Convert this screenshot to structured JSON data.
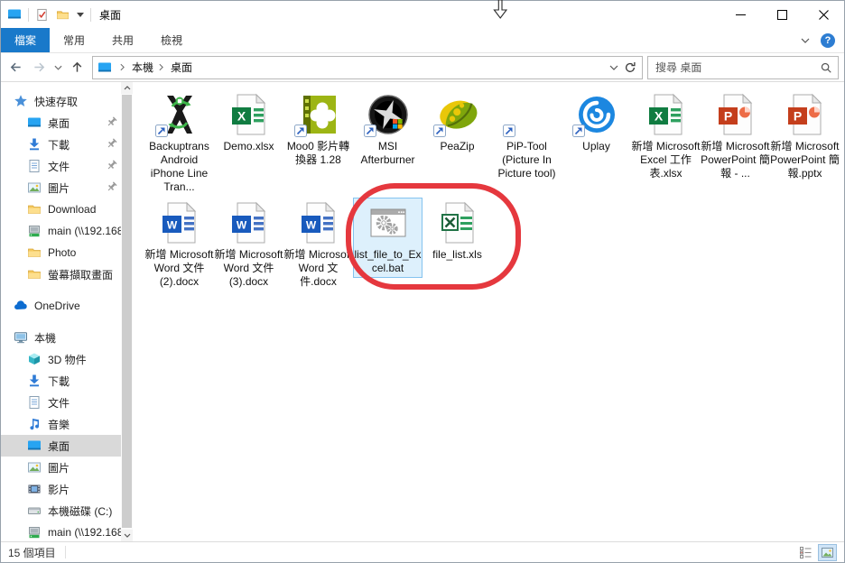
{
  "window": {
    "title": "桌面"
  },
  "ribbon": {
    "file_tab": "檔案",
    "tabs": [
      {
        "label": "常用"
      },
      {
        "label": "共用"
      },
      {
        "label": "檢視"
      }
    ]
  },
  "navigation": {
    "path_segments": [
      {
        "label": "本機"
      },
      {
        "label": "桌面"
      }
    ],
    "search_placeholder": "搜尋 桌面"
  },
  "sidebar": {
    "items": [
      {
        "label": "快速存取",
        "icon": "quickaccess",
        "level": 0
      },
      {
        "label": "桌面",
        "icon": "desktop",
        "level": 1,
        "pinned": true
      },
      {
        "label": "下載",
        "icon": "download",
        "level": 1,
        "pinned": true
      },
      {
        "label": "文件",
        "icon": "document",
        "level": 1,
        "pinned": true
      },
      {
        "label": "圖片",
        "icon": "pictures",
        "level": 1,
        "pinned": true
      },
      {
        "label": "Download",
        "icon": "folder",
        "level": 1
      },
      {
        "label": "main (\\\\192.168",
        "icon": "network",
        "level": 1
      },
      {
        "label": "Photo",
        "icon": "folder",
        "level": 1
      },
      {
        "label": "螢幕擷取畫面",
        "icon": "folder",
        "level": 1
      },
      {
        "label": "OneDrive",
        "icon": "onedrive",
        "level": 0,
        "gap": true
      },
      {
        "label": "本機",
        "icon": "thispc",
        "level": 0,
        "gap": true
      },
      {
        "label": "3D 物件",
        "icon": "objects3d",
        "level": 1
      },
      {
        "label": "下載",
        "icon": "download",
        "level": 1
      },
      {
        "label": "文件",
        "icon": "document",
        "level": 1
      },
      {
        "label": "音樂",
        "icon": "music",
        "level": 1
      },
      {
        "label": "桌面",
        "icon": "desktop",
        "level": 1,
        "selected": true
      },
      {
        "label": "圖片",
        "icon": "pictures",
        "level": 1
      },
      {
        "label": "影片",
        "icon": "videos",
        "level": 1
      },
      {
        "label": "本機磁碟 (C:)",
        "icon": "disk",
        "level": 1
      },
      {
        "label": "main (\\\\192.168",
        "icon": "network",
        "level": 1
      }
    ]
  },
  "files": [
    {
      "label": "Backuptrans Android iPhone Line Tran...",
      "icon": "backuptrans",
      "shortcut": true
    },
    {
      "label": "Demo.xlsx",
      "icon": "excel"
    },
    {
      "label": "Moo0 影片轉換器 1.28",
      "icon": "moo0",
      "shortcut": true
    },
    {
      "label": "MSI Afterburner",
      "icon": "msi",
      "shortcut": true
    },
    {
      "label": "PeaZip",
      "icon": "peazip",
      "shortcut": true
    },
    {
      "label": "PiP-Tool (Picture In Picture tool)",
      "icon": "blank",
      "shortcut": true
    },
    {
      "label": "Uplay",
      "icon": "uplay",
      "shortcut": true
    },
    {
      "label": "新增 Microsoft Excel 工作表.xlsx",
      "icon": "excel"
    },
    {
      "label": "新增 Microsoft PowerPoint 簡報 - ...",
      "icon": "powerpoint"
    },
    {
      "label": "新增 Microsoft PowerPoint 簡報.pptx",
      "icon": "powerpoint"
    },
    {
      "label": "新增 Microsoft Word 文件 (2).docx",
      "icon": "word"
    },
    {
      "label": "新增 Microsoft Word 文件 (3).docx",
      "icon": "word"
    },
    {
      "label": "新增 Microsoft Word 文件.docx",
      "icon": "word"
    },
    {
      "label": "list_file_to_Excel.bat",
      "icon": "bat",
      "selected": true
    },
    {
      "label": "file_list.xls",
      "icon": "xlsold"
    }
  ],
  "status_bar": {
    "items_count": "15 個項目"
  },
  "colors": {
    "file_tab_blue": "#1979ca",
    "annotation_red": "#e5383e",
    "selection_fill": "#ddf0fc",
    "selection_border": "#84c3ef",
    "sidebar_selected": "#d9d9d9"
  }
}
